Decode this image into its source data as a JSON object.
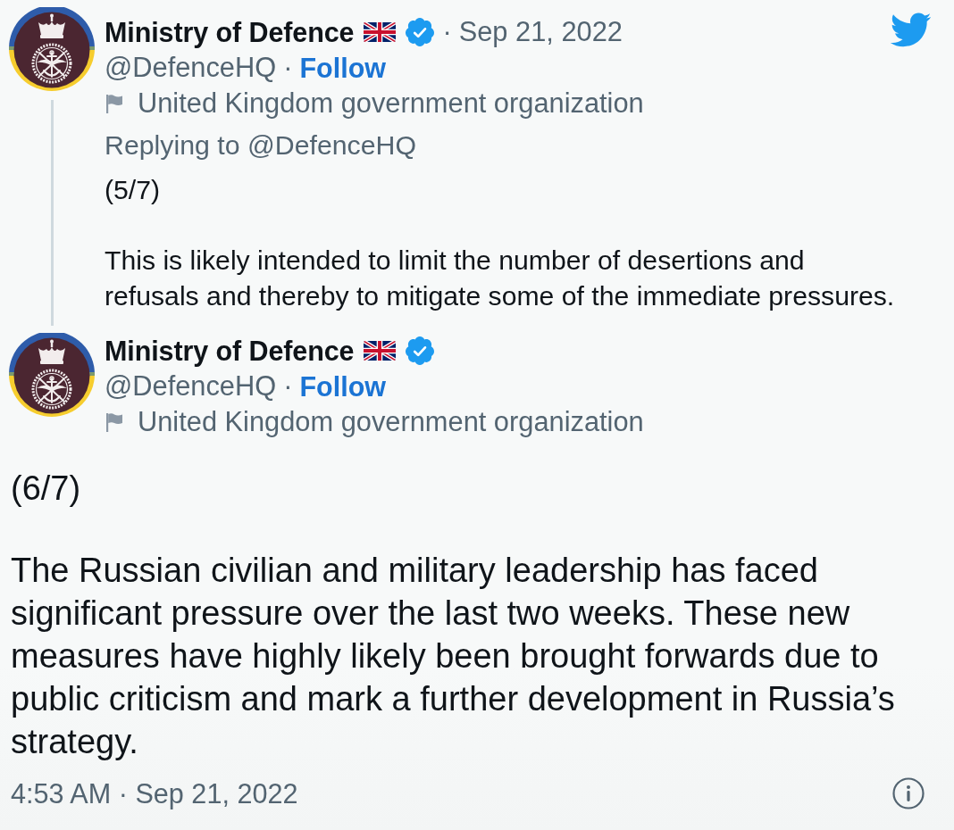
{
  "tweets": [
    {
      "kind": "parent",
      "author": {
        "name": "Ministry of Defence",
        "verified": true,
        "handle": "@DefenceHQ",
        "handle_separator": "·",
        "follow": "Follow",
        "label": "United Kingdom government organization"
      },
      "date_separator": "·",
      "date": "Sep 21, 2022",
      "replying_to": "Replying to @DefenceHQ",
      "paragraphs": [
        "(5/7)",
        "This is likely intended to limit the number of desertions and refusals and thereby to mitigate some of the immediate pressures."
      ]
    },
    {
      "kind": "main",
      "author": {
        "name": "Ministry of Defence",
        "verified": true,
        "handle": "@DefenceHQ",
        "handle_separator": "·",
        "follow": "Follow",
        "label": "United Kingdom government organization"
      },
      "paragraphs": [
        "(6/7)",
        "The Russian civilian and military leadership has faced significant pressure over the last two weeks. These new measures have highly likely been brought forwards due to public criticism and mark a further development in Russia’s strategy."
      ],
      "timestamp": "4:53 AM · Sep 21, 2022"
    }
  ]
}
